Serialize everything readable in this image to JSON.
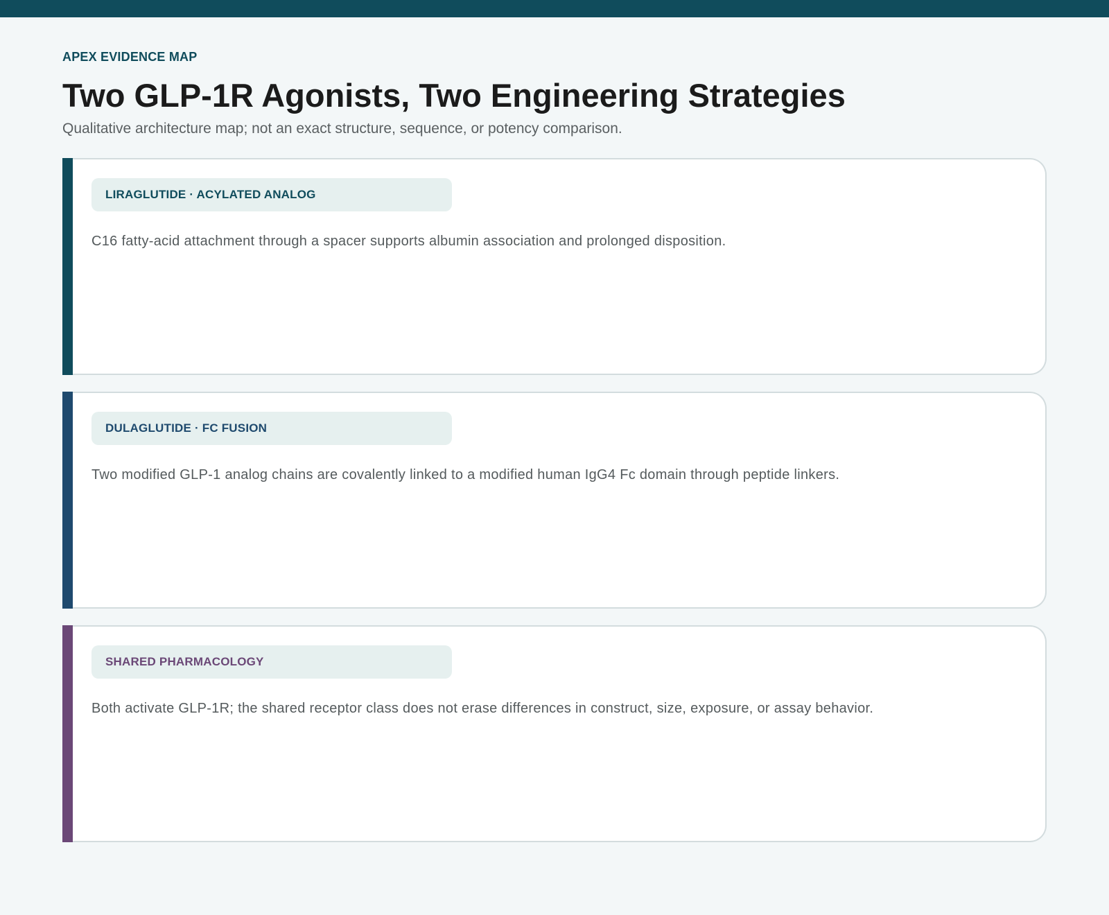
{
  "colors": {
    "topbar": "#104c5c",
    "background": "#f3f7f8",
    "card_border": "#d3dcde",
    "tag_background": "#e6f0ef"
  },
  "header": {
    "kicker": "APEX EVIDENCE MAP",
    "title": "Two GLP-1R Agonists, Two Engineering Strategies",
    "subtitle": "Qualitative architecture map; not an exact structure, sequence, or potency comparison."
  },
  "cards": [
    {
      "tag": "LIRAGLUTIDE · ACYLATED ANALOG",
      "description": "C16 fatty-acid attachment through a spacer supports albumin association and prolonged disposition.",
      "accent_color": "#104c5c"
    },
    {
      "tag": "DULAGLUTIDE · FC FUSION",
      "description": "Two modified GLP-1 analog chains are covalently linked to a modified human IgG4 Fc domain through peptide linkers.",
      "accent_color": "#1f4a6e"
    },
    {
      "tag": "SHARED PHARMACOLOGY",
      "description": "Both activate GLP-1R; the shared receptor class does not erase differences in construct, size, exposure, or assay behavior.",
      "accent_color": "#6b4877"
    }
  ]
}
